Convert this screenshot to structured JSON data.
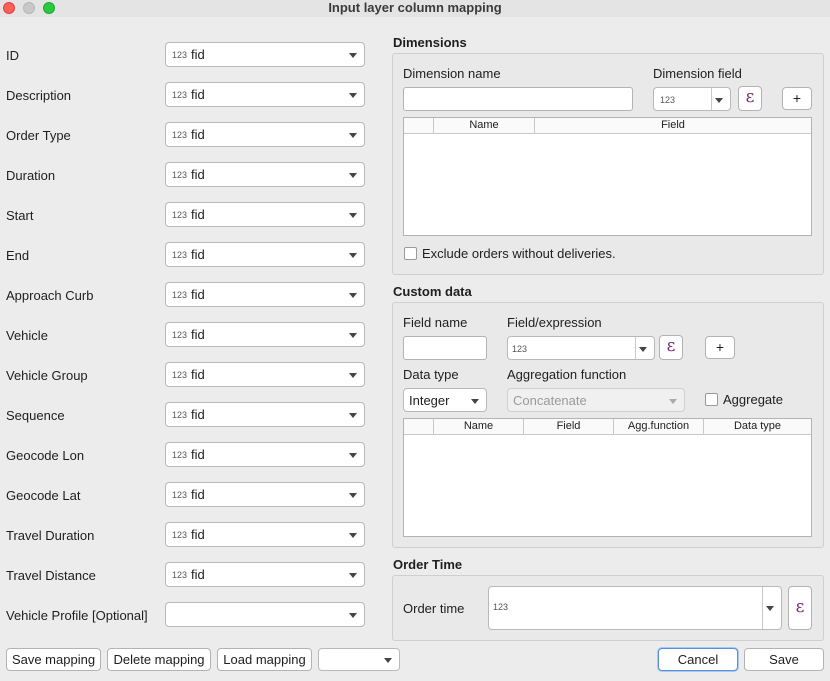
{
  "window": {
    "title": "Input layer column mapping"
  },
  "mapping": {
    "rows": [
      {
        "label": "ID",
        "type_badge": "123",
        "value": "fid"
      },
      {
        "label": "Description",
        "type_badge": "123",
        "value": "fid"
      },
      {
        "label": "Order Type",
        "type_badge": "123",
        "value": "fid"
      },
      {
        "label": "Duration",
        "type_badge": "123",
        "value": "fid"
      },
      {
        "label": "Start",
        "type_badge": "123",
        "value": "fid"
      },
      {
        "label": "End",
        "type_badge": "123",
        "value": "fid"
      },
      {
        "label": "Approach Curb",
        "type_badge": "123",
        "value": "fid"
      },
      {
        "label": "Vehicle",
        "type_badge": "123",
        "value": "fid"
      },
      {
        "label": "Vehicle Group",
        "type_badge": "123",
        "value": "fid"
      },
      {
        "label": "Sequence",
        "type_badge": "123",
        "value": "fid"
      },
      {
        "label": "Geocode Lon",
        "type_badge": "123",
        "value": "fid"
      },
      {
        "label": "Geocode Lat",
        "type_badge": "123",
        "value": "fid"
      },
      {
        "label": "Travel Duration",
        "type_badge": "123",
        "value": "fid"
      },
      {
        "label": "Travel Distance",
        "type_badge": "123",
        "value": "fid"
      },
      {
        "label": "Vehicle Profile [Optional]",
        "type_badge": "",
        "value": ""
      }
    ]
  },
  "dimensions": {
    "title": "Dimensions",
    "name_label": "Dimension name",
    "name_value": "",
    "field_label": "Dimension field",
    "field_badge": "123",
    "add_label": "+",
    "table_headers": [
      "Name",
      "Field"
    ],
    "exclude_label": "Exclude orders without deliveries.",
    "exclude_checked": false
  },
  "custom_data": {
    "title": "Custom data",
    "field_name_label": "Field name",
    "field_name_value": "",
    "expression_label": "Field/expression",
    "expression_badge": "123",
    "add_label": "+",
    "data_type_label": "Data type",
    "data_type_value": "Integer",
    "aggregation_label": "Aggregation function",
    "aggregation_value": "Concatenate",
    "aggregate_label": "Aggregate",
    "aggregate_checked": false,
    "table_headers": [
      "Name",
      "Field",
      "Agg.function",
      "Data type"
    ]
  },
  "order_time": {
    "title": "Order Time",
    "label": "Order time",
    "badge": "123"
  },
  "buttons": {
    "save_mapping": "Save mapping",
    "delete_mapping": "Delete mapping",
    "load_mapping": "Load mapping",
    "mapping_select_value": "",
    "cancel": "Cancel",
    "save": "Save"
  },
  "icons": {
    "expression": "epsilon-icon",
    "dropdown": "chevron-down-icon"
  },
  "colors": {
    "epsilon": "#7a2a7a",
    "default_button_border": "#5a8fd9"
  }
}
